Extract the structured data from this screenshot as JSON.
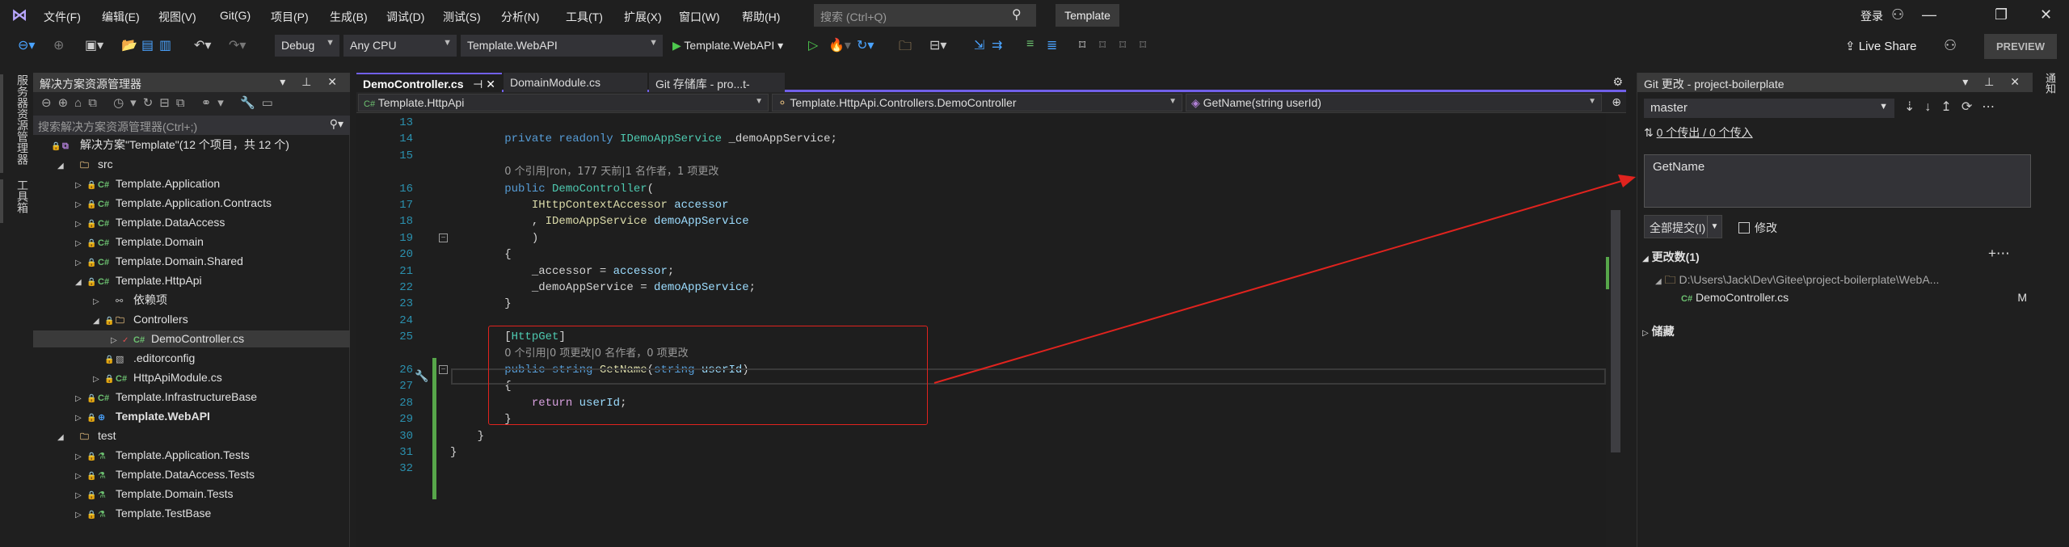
{
  "menu": {
    "items": [
      "文件(F)",
      "编辑(E)",
      "视图(V)",
      "Git(G)",
      "项目(P)",
      "生成(B)",
      "调试(D)",
      "测试(S)",
      "分析(N)",
      "工具(T)",
      "扩展(X)",
      "窗口(W)",
      "帮助(H)"
    ],
    "search_placeholder": "搜索 (Ctrl+Q)",
    "solution_name": "Template",
    "login": "登录"
  },
  "toolbar": {
    "config": "Debug",
    "platform": "Any CPU",
    "startup_project": "Template.WebAPI",
    "run_label": "Template.WebAPI",
    "live_share": "Live Share",
    "preview": "PREVIEW"
  },
  "left_strip": {
    "server_explorer": "服务器资源管理器",
    "toolbox": "工具箱"
  },
  "right_strip": {
    "notifications": "通知"
  },
  "solution_explorer": {
    "title": "解决方案资源管理器",
    "search_placeholder": "搜索解决方案资源管理器(Ctrl+;)",
    "tree": [
      {
        "label": "解决方案\"Template\"(12 个项目，共 12 个)",
        "level": 0,
        "icon": "solution",
        "toggle": "",
        "lock": true
      },
      {
        "label": "src",
        "level": 1,
        "icon": "folder",
        "toggle": "expanded",
        "lock": false
      },
      {
        "label": "Template.Application",
        "level": 2,
        "icon": "csproj",
        "toggle": "collapsed",
        "lock": true
      },
      {
        "label": "Template.Application.Contracts",
        "level": 2,
        "icon": "csproj",
        "toggle": "collapsed",
        "lock": true
      },
      {
        "label": "Template.DataAccess",
        "level": 2,
        "icon": "csproj",
        "toggle": "collapsed",
        "lock": true
      },
      {
        "label": "Template.Domain",
        "level": 2,
        "icon": "csproj",
        "toggle": "collapsed",
        "lock": true
      },
      {
        "label": "Template.Domain.Shared",
        "level": 2,
        "icon": "csproj",
        "toggle": "collapsed",
        "lock": true
      },
      {
        "label": "Template.HttpApi",
        "level": 2,
        "icon": "csproj",
        "toggle": "expanded",
        "lock": true
      },
      {
        "label": "依赖项",
        "level": 3,
        "icon": "dependencies",
        "toggle": "collapsed",
        "lock": false
      },
      {
        "label": "Controllers",
        "level": 3,
        "icon": "folder",
        "toggle": "expanded",
        "lock": true
      },
      {
        "label": "DemoController.cs",
        "level": 4,
        "icon": "csfile",
        "toggle": "collapsed",
        "lock": false,
        "modified": true,
        "selected": true
      },
      {
        "label": ".editorconfig",
        "level": 3,
        "icon": "file",
        "toggle": "",
        "lock": true
      },
      {
        "label": "HttpApiModule.cs",
        "level": 3,
        "icon": "csfile",
        "toggle": "collapsed",
        "lock": true
      },
      {
        "label": "Template.InfrastructureBase",
        "level": 2,
        "icon": "csproj",
        "toggle": "collapsed",
        "lock": true
      },
      {
        "label": "Template.WebAPI",
        "level": 2,
        "icon": "webproj",
        "toggle": "collapsed",
        "lock": true,
        "bold": true
      },
      {
        "label": "test",
        "level": 1,
        "icon": "folder",
        "toggle": "expanded",
        "lock": false
      },
      {
        "label": "Template.Application.Tests",
        "level": 2,
        "icon": "testproj",
        "toggle": "collapsed",
        "lock": true
      },
      {
        "label": "Template.DataAccess.Tests",
        "level": 2,
        "icon": "testproj",
        "toggle": "collapsed",
        "lock": true
      },
      {
        "label": "Template.Domain.Tests",
        "level": 2,
        "icon": "testproj",
        "toggle": "collapsed",
        "lock": true
      },
      {
        "label": "Template.TestBase",
        "level": 2,
        "icon": "testproj",
        "toggle": "collapsed",
        "lock": true
      }
    ]
  },
  "editor": {
    "tabs": [
      {
        "label": "DemoController.cs",
        "active": true
      },
      {
        "label": "DomainModule.cs",
        "active": false
      },
      {
        "label": "Git 存储库 - pro...t-boilerplate",
        "active": false
      }
    ],
    "nav": {
      "project": "Template.HttpApi",
      "type": "Template.HttpApi.Controllers.DemoController",
      "member": "GetName(string userId)"
    },
    "lines": [
      {
        "n": "13",
        "tokens": []
      },
      {
        "n": "14",
        "tokens": [
          {
            "t": "        ",
            "c": "pl"
          },
          {
            "t": "private readonly ",
            "c": "kw"
          },
          {
            "t": "IDemoAppService",
            "c": "ty"
          },
          {
            "t": " _demoAppService;",
            "c": "pl"
          }
        ]
      },
      {
        "n": "15",
        "tokens": []
      },
      {
        "n": "",
        "tokens": [
          {
            "t": "        ",
            "c": "pl"
          },
          {
            "t": "0 个引用|ron，177 天前|1 名作者，1 项更改",
            "c": "cm"
          }
        ]
      },
      {
        "n": "16",
        "tokens": [
          {
            "t": "        ",
            "c": "pl"
          },
          {
            "t": "public ",
            "c": "kw"
          },
          {
            "t": "DemoController",
            "c": "ty"
          },
          {
            "t": "(",
            "c": "pl"
          }
        ]
      },
      {
        "n": "17",
        "tokens": [
          {
            "t": "            ",
            "c": "pl"
          },
          {
            "t": "IHttpContextAccessor",
            "c": "fn"
          },
          {
            "t": " accessor",
            "c": "pa"
          }
        ]
      },
      {
        "n": "18",
        "tokens": [
          {
            "t": "            , ",
            "c": "pl"
          },
          {
            "t": "IDemoAppService",
            "c": "fn"
          },
          {
            "t": " demoAppService",
            "c": "pa"
          }
        ]
      },
      {
        "n": "19",
        "tokens": [
          {
            "t": "            )",
            "c": "pl"
          }
        ]
      },
      {
        "n": "20",
        "tokens": [
          {
            "t": "        {",
            "c": "pl"
          }
        ]
      },
      {
        "n": "21",
        "tokens": [
          {
            "t": "            _accessor = ",
            "c": "pl"
          },
          {
            "t": "accessor",
            "c": "pa"
          },
          {
            "t": ";",
            "c": "pl"
          }
        ]
      },
      {
        "n": "22",
        "tokens": [
          {
            "t": "            _demoAppService = ",
            "c": "pl"
          },
          {
            "t": "demoAppService",
            "c": "pa"
          },
          {
            "t": ";",
            "c": "pl"
          }
        ]
      },
      {
        "n": "23",
        "tokens": [
          {
            "t": "        }",
            "c": "pl"
          }
        ]
      },
      {
        "n": "24",
        "tokens": []
      },
      {
        "n": "25",
        "tokens": [
          {
            "t": "        [",
            "c": "pl"
          },
          {
            "t": "HttpGet",
            "c": "ty"
          },
          {
            "t": "]",
            "c": "pl"
          }
        ]
      },
      {
        "n": "",
        "tokens": [
          {
            "t": "        ",
            "c": "pl"
          },
          {
            "t": "0 个引用|0 项更改|0 名作者，0 项更改",
            "c": "cm"
          }
        ]
      },
      {
        "n": "26",
        "tokens": [
          {
            "t": "        ",
            "c": "pl"
          },
          {
            "t": "public string ",
            "c": "kw"
          },
          {
            "t": "GetName",
            "c": "fn"
          },
          {
            "t": "(",
            "c": "pl"
          },
          {
            "t": "string ",
            "c": "kw"
          },
          {
            "t": "userId",
            "c": "pa"
          },
          {
            "t": ")",
            "c": "pl"
          }
        ]
      },
      {
        "n": "27",
        "tokens": [
          {
            "t": "        {",
            "c": "pl"
          }
        ]
      },
      {
        "n": "28",
        "tokens": [
          {
            "t": "            ",
            "c": "pl"
          },
          {
            "t": "return ",
            "c": "ct"
          },
          {
            "t": "userId",
            "c": "pa"
          },
          {
            "t": ";",
            "c": "pl"
          }
        ]
      },
      {
        "n": "29",
        "tokens": [
          {
            "t": "        }",
            "c": "pl"
          }
        ]
      },
      {
        "n": "30",
        "tokens": [
          {
            "t": "    }",
            "c": "pl"
          }
        ]
      },
      {
        "n": "31",
        "tokens": [
          {
            "t": "}",
            "c": "pl"
          }
        ]
      },
      {
        "n": "32",
        "tokens": []
      }
    ]
  },
  "git_changes": {
    "title": "Git 更改 - project-boilerplate",
    "branch": "master",
    "sync": "0 个传出 / 0 个传入",
    "commit_message": "GetName",
    "commit_button": "全部提交(I)",
    "amend_label": "修改",
    "changes_header": "更改数(1)",
    "path": "D:\\Users\\Jack\\Dev\\Gitee\\project-boilerplate\\WebA...",
    "files": [
      {
        "name": "DemoController.cs",
        "status": "M"
      }
    ],
    "stash_header": "储藏"
  },
  "colors": {
    "accent": "#7160e8",
    "annotation": "#e0231e",
    "change_bar": "#57a64a"
  }
}
